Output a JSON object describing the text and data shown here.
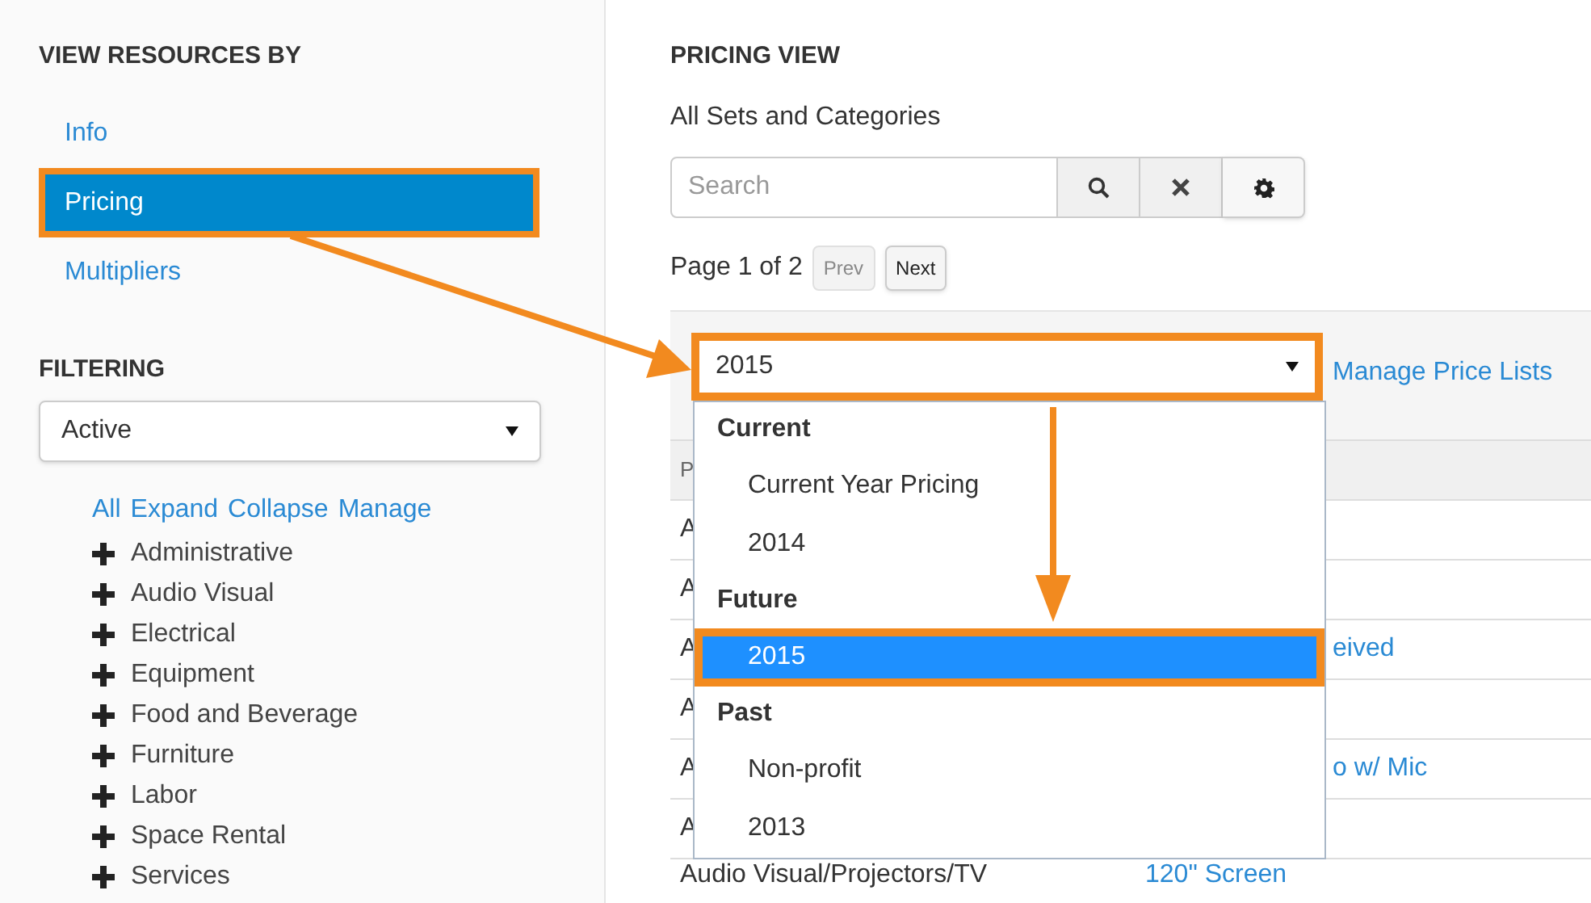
{
  "sidebar": {
    "heading": "VIEW RESOURCES BY",
    "view_items": [
      {
        "label": "Info",
        "selected": false,
        "highlighted": false
      },
      {
        "label": "Pricing",
        "selected": true,
        "highlighted": true
      },
      {
        "label": "Multipliers",
        "selected": false,
        "highlighted": false
      }
    ],
    "filter_heading": "FILTERING",
    "filter_select": {
      "value": "Active"
    },
    "tree_links": [
      "All",
      "Expand",
      "Collapse",
      "Manage"
    ],
    "categories": [
      {
        "label": "Administrative"
      },
      {
        "label": "Audio Visual"
      },
      {
        "label": "Electrical"
      },
      {
        "label": "Equipment"
      },
      {
        "label": "Food and Beverage"
      },
      {
        "label": "Furniture"
      },
      {
        "label": "Labor"
      },
      {
        "label": "Space Rental"
      },
      {
        "label": "Services"
      }
    ]
  },
  "main": {
    "title": "PRICING VIEW",
    "subtitle": "All Sets and Categories",
    "search": {
      "placeholder": "Search"
    },
    "pager": {
      "text": "Page 1 of 2",
      "prev": {
        "label": "Prev",
        "disabled": true
      },
      "next": {
        "label": "Next",
        "disabled": false
      }
    },
    "price_list_select": {
      "value": "2015",
      "highlighted": true
    },
    "manage_link": "Manage Price Lists",
    "table": {
      "header_cell": "P",
      "rows": [
        {
          "kind": "covered",
          "column_1": "A"
        },
        {
          "kind": "covered",
          "column_1": "A"
        },
        {
          "kind": "covered",
          "column_1": "A",
          "column_2": "eived"
        },
        {
          "kind": "covered",
          "column_1": "A"
        },
        {
          "kind": "covered",
          "column_1": "A",
          "column_2": "o w/ Mic"
        },
        {
          "kind": "covered",
          "column_1": "A"
        },
        {
          "kind": "full",
          "column_1": "Audio Visual/Projectors/TV",
          "column_2": "120\" Screen"
        }
      ]
    },
    "dropdown": {
      "groups": [
        {
          "label": "Current",
          "options": [
            {
              "label": "Current Year Pricing",
              "selected": false,
              "highlighted": false
            },
            {
              "label": "2014",
              "selected": false,
              "highlighted": false
            }
          ]
        },
        {
          "label": "Future",
          "options": [
            {
              "label": "2015",
              "selected": true,
              "highlighted": true
            }
          ]
        },
        {
          "label": "Past",
          "options": [
            {
              "label": "Non-profit",
              "selected": false,
              "highlighted": false
            },
            {
              "label": "2013",
              "selected": false,
              "highlighted": false
            }
          ]
        }
      ]
    }
  }
}
